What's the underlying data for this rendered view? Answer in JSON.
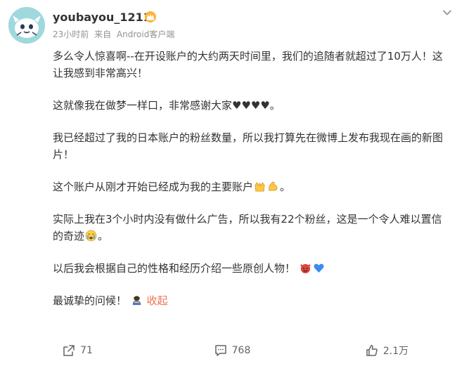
{
  "post": {
    "username": "youbayou_1211",
    "time": "23小时前",
    "source_prefix": "来自",
    "source": "Android客户端",
    "paragraphs": [
      {
        "text": "多么令人惊喜啊--在开设账户的大约两天时间里，我们的追随者就超过了10万人！这让我感到非常高兴！"
      },
      {
        "text": "这就像我在做梦一样口，非常感谢大家♥♥♥♥。"
      },
      {
        "text": "我已经超过了我的日本账户的粉丝数量，所以我打算先在微博上发布我现在画的新图片！"
      },
      {
        "text_before": "这个账户从刚才开始已经成为我的主要账户",
        "text_after": "。"
      },
      {
        "text_before": "实际上我在3个小时内没有做什么广告，所以我有22个粉丝，这是一个令人难以置信的奇迹",
        "text_after": "。"
      },
      {
        "text": "以后我会根据自己的性格和经历介绍一些原创人物！"
      },
      {
        "text": "最诚挚的问候！"
      }
    ],
    "collapse_label": "收起"
  },
  "actions": {
    "repost_count": "71",
    "comment_count": "768",
    "like_count": "2.1万"
  },
  "colors": {
    "accent": "#eb7350",
    "meta_gray": "#939393",
    "avatar_bg": "#9fd9de"
  },
  "icons": [
    "avatar-icon",
    "vip-crown-icon",
    "chevron-down-icon",
    "raising-hands-emoji",
    "flexed-biceps-emoji",
    "crying-face-emoji",
    "devil-emoji",
    "blue-heart-emoji",
    "bowing-person-emoji",
    "repost-icon",
    "comment-icon",
    "like-icon"
  ]
}
